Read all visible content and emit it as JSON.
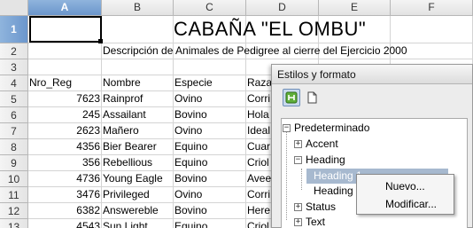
{
  "columns": [
    "A",
    "B",
    "C",
    "D",
    "E",
    "F"
  ],
  "active_column": "A",
  "rows": [
    "1",
    "2",
    "3",
    "4",
    "5",
    "6",
    "7",
    "8",
    "9",
    "10",
    "11",
    "12",
    "13"
  ],
  "active_row": "1",
  "sheet": {
    "title": "CABAÑA  \"EL OMBU\"",
    "description": "Descripción de Animales de Pedigree al cierre del Ejercicio 2000",
    "headers": [
      "Nro_Reg",
      "Nombre",
      "Especie",
      "Raza"
    ],
    "records": [
      {
        "nro": "7623",
        "nombre": "Rainprof",
        "especie": "Ovino",
        "raza": "Corri"
      },
      {
        "nro": "245",
        "nombre": "Assailant",
        "especie": "Bovino",
        "raza": "Hola"
      },
      {
        "nro": "2623",
        "nombre": "Mañero",
        "especie": "Ovino",
        "raza": "Ideal"
      },
      {
        "nro": "4356",
        "nombre": "Bier Bearer",
        "especie": "Equino",
        "raza": "Cuar"
      },
      {
        "nro": "356",
        "nombre": "Rebellious",
        "especie": "Equino",
        "raza": "Criol"
      },
      {
        "nro": "4736",
        "nombre": "Young Eagle",
        "especie": "Bovino",
        "raza": "Avee"
      },
      {
        "nro": "3476",
        "nombre": "Privileged",
        "especie": "Ovino",
        "raza": "Corri"
      },
      {
        "nro": "6382",
        "nombre": "Answereble",
        "especie": "Bovino",
        "raza": "Here"
      },
      {
        "nro": "4543",
        "nombre": "Sun Light",
        "especie": "Equino",
        "raza": "Criol"
      }
    ]
  },
  "panel": {
    "title": "Estilos y formato",
    "toolbar": [
      "paragraph-styles-icon",
      "page-styles-icon"
    ],
    "tree": {
      "root": "Predeterminado",
      "accent": "Accent",
      "heading": "Heading",
      "heading1": "Heading 1",
      "heading2": "Heading 2",
      "status": "Status",
      "text": "Text"
    }
  },
  "context_menu": {
    "new_label": "Nuevo...",
    "modify_label": "Modificar..."
  },
  "colors": {
    "selection_blue": "#6b96cc",
    "tree_selection": "#a7b9cf"
  }
}
